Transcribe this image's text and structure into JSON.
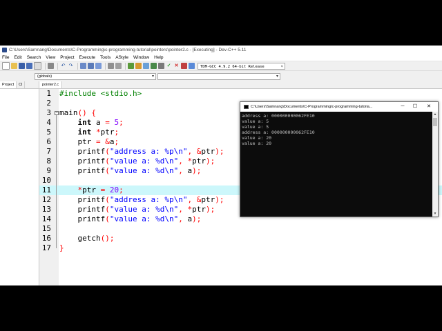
{
  "window": {
    "title": "C:\\Users\\Samnang\\Documents\\C-Programming\\c-programming-tutorial\\pointers\\pointer2.c - [Executing] - Dev-C++ 5.11"
  },
  "menu": [
    "File",
    "Edit",
    "Search",
    "View",
    "Project",
    "Execute",
    "Tools",
    "AStyle",
    "Window",
    "Help"
  ],
  "toolbar": {
    "compiler": "TDM-GCC 4.9.2 64-bit Release",
    "globals": "(globals)"
  },
  "left_panel": {
    "tabs": [
      "Project",
      "Cl"
    ]
  },
  "editor": {
    "file_tab": "pointer2.c",
    "current_line": 11,
    "line_numbers": [
      "1",
      "2",
      "3",
      "4",
      "5",
      "6",
      "7",
      "8",
      "9",
      "10",
      "11",
      "12",
      "13",
      "14",
      "15",
      "16",
      "17"
    ],
    "lines": [
      "#include <stdio.h>",
      "",
      "main() {",
      "    int a = 5;",
      "    int *ptr;",
      "    ptr = &a;",
      "    printf(\"address a: %p\\n\", &ptr);",
      "    printf(\"value a: %d\\n\", *ptr);",
      "    printf(\"value a: %d\\n\", a);",
      "",
      "    *ptr = 20;",
      "    printf(\"address a: %p\\n\", &ptr);",
      "    printf(\"value a: %d\\n\", *ptr);",
      "    printf(\"value a: %d\\n\", a);",
      "",
      "    getch();",
      "}"
    ]
  },
  "console": {
    "title": "C:\\Users\\Samnang\\Documents\\C-Programming\\c-programming-tutoria...",
    "output": [
      "address a: 000000000062FE10",
      "value a: 5",
      "value a: 5",
      "address a: 000000000062FE10",
      "value a: 20",
      "value a: 20"
    ]
  },
  "colors": {
    "current_line_bg": "#ccf7fb",
    "preprocessor": "#008000",
    "string": "#0000ff",
    "number": "#8000ff",
    "symbol": "#ff0000",
    "console_bg": "#0c0c0c",
    "console_text": "#c0c0c0"
  },
  "icons": [
    "app-icon",
    "new-icon",
    "open-icon",
    "save-icon",
    "save-all-icon",
    "close-icon",
    "print-icon",
    "undo-icon",
    "redo-icon",
    "find-icon",
    "replace-icon",
    "goto-icon",
    "indent-icon",
    "unindent-icon",
    "bookmark-icon",
    "compile-icon",
    "run-icon",
    "compile-run-icon",
    "rebuild-icon",
    "check-icon",
    "stop-icon",
    "debug-icon",
    "chart-icon",
    "minimize-icon",
    "maximize-icon",
    "close-window-icon"
  ]
}
